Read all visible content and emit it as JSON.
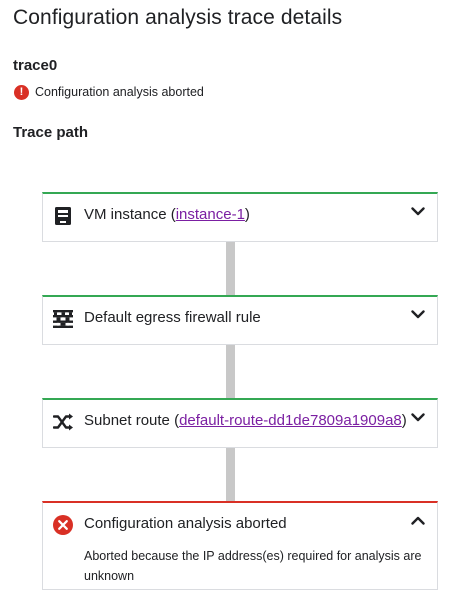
{
  "page": {
    "title": "Configuration analysis trace details",
    "trace_name": "trace0",
    "status_text": "Configuration analysis aborted",
    "trace_path_title": "Trace path"
  },
  "colors": {
    "success_border": "#34a853",
    "error_border": "#d93025",
    "link": "#7b1fa2",
    "connector": "#c8c8c8"
  },
  "steps": [
    {
      "icon": "vm-instance-icon",
      "prefix": "VM instance (",
      "link": "instance-1",
      "suffix": ")",
      "status": "ok",
      "expanded": false
    },
    {
      "icon": "firewall-icon",
      "prefix": "Default egress firewall rule",
      "link": "",
      "suffix": "",
      "status": "ok",
      "expanded": false
    },
    {
      "icon": "route-icon",
      "prefix": "Subnet route (",
      "link": "default-route-dd1de7809a1909a8",
      "suffix": ")",
      "status": "ok",
      "expanded": false
    },
    {
      "icon": "error-circle-icon",
      "prefix": "Configuration analysis aborted",
      "link": "",
      "suffix": "",
      "status": "error",
      "expanded": true,
      "detail": "Aborted because the IP address(es) required for analysis are unknown"
    }
  ]
}
